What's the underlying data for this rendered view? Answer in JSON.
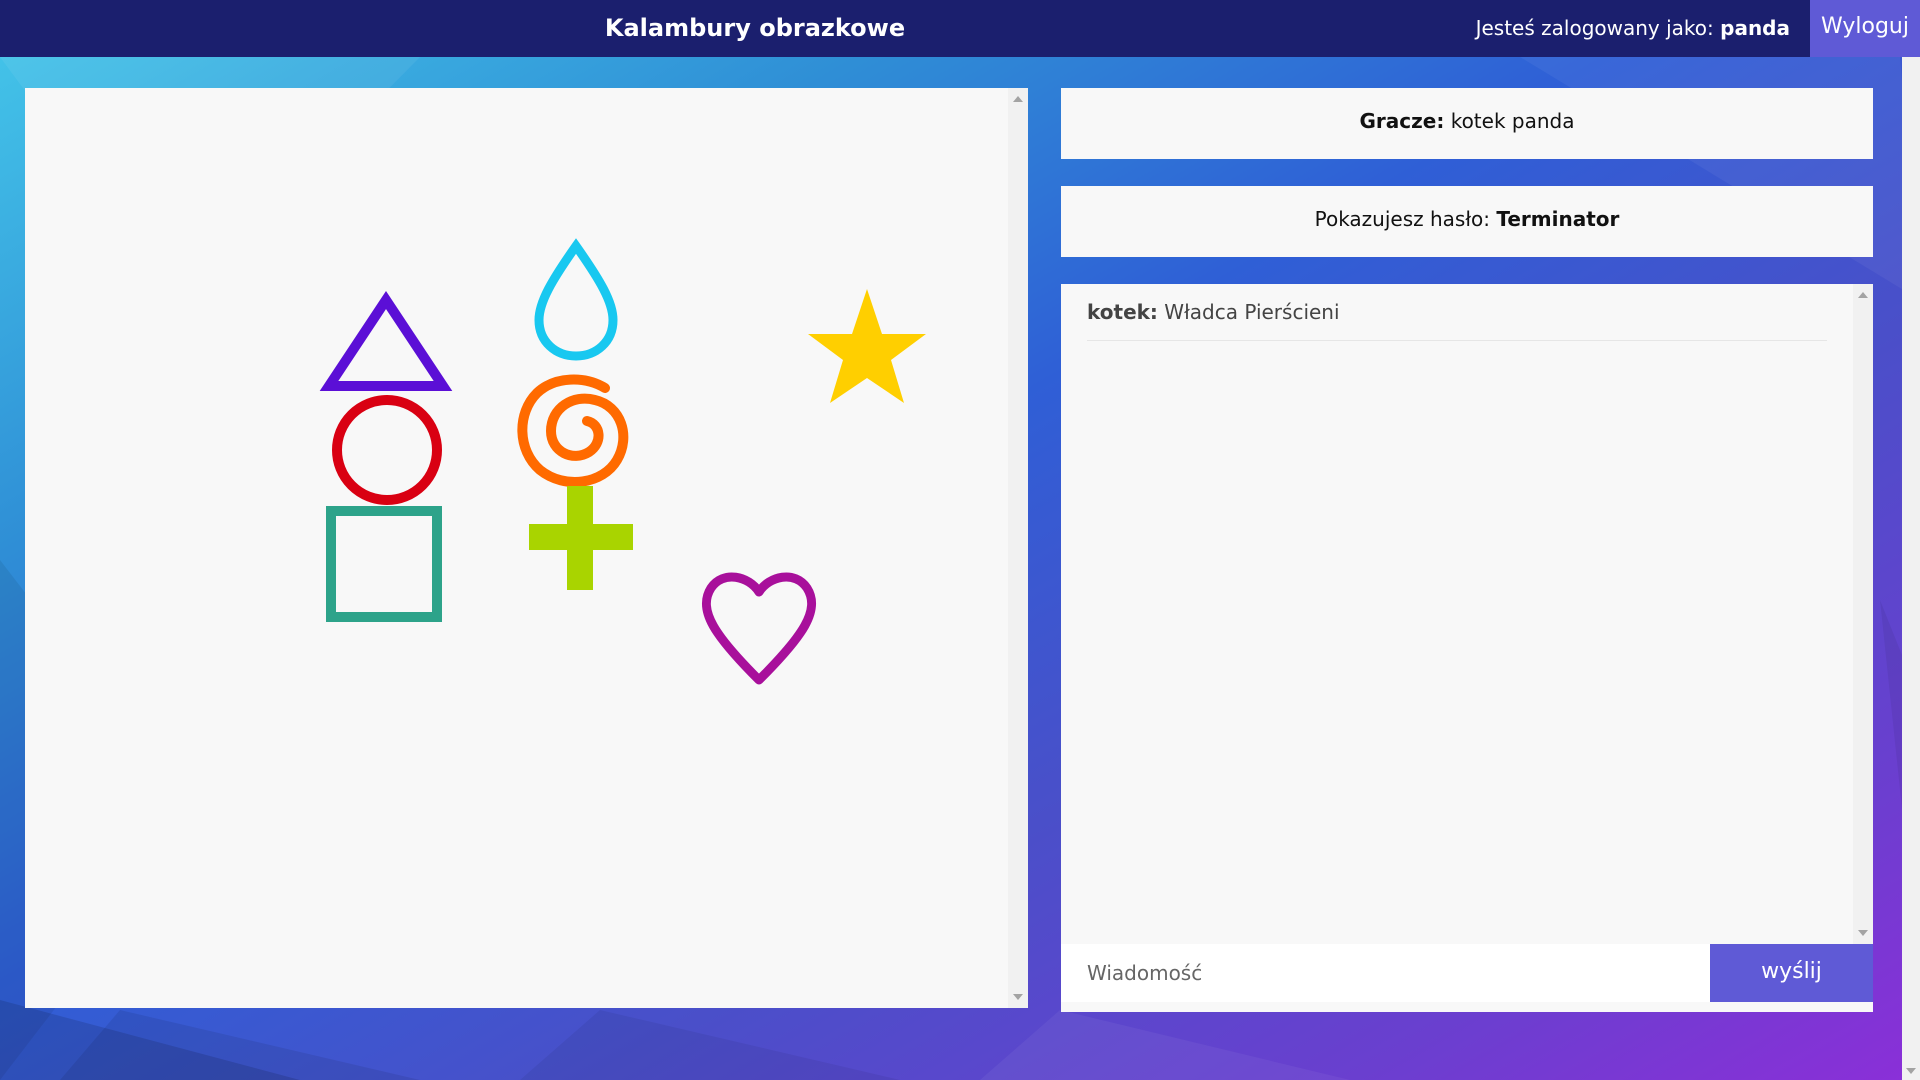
{
  "header": {
    "title": "Kalambury obrazkowe",
    "logged_prefix": "Jesteś zalogowany jako: ",
    "username": "panda",
    "logout_label": "Wyloguj"
  },
  "players": {
    "label": "Gracze:",
    "names": "kotek panda"
  },
  "secret": {
    "label": "Pokazujesz hasło: ",
    "word": "Terminator"
  },
  "chat": {
    "messages": [
      {
        "author": "kotek:",
        "text": "Władca Pierścieni"
      }
    ],
    "input_placeholder": "Wiadomość",
    "send_label": "wyślij"
  },
  "drawing": {
    "shapes": [
      {
        "name": "triangle",
        "color": "#5b0fd6"
      },
      {
        "name": "circle",
        "color": "#d90012"
      },
      {
        "name": "square",
        "color": "#2da38a"
      },
      {
        "name": "drop",
        "color": "#18c8f0"
      },
      {
        "name": "spiral",
        "color": "#ff6a00"
      },
      {
        "name": "plus",
        "color": "#a9d400"
      },
      {
        "name": "star",
        "color": "#ffcf00"
      },
      {
        "name": "heart",
        "color": "#a8109b"
      }
    ]
  },
  "colors": {
    "topbar": "#1b1f6e",
    "accent": "#5f5ad6",
    "panel": "#f8f8f8"
  }
}
